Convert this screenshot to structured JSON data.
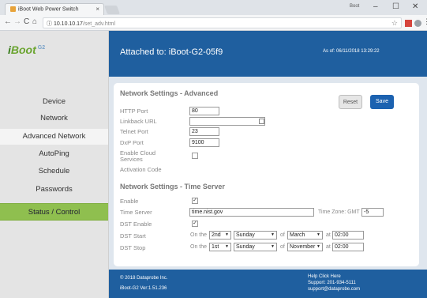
{
  "browser": {
    "tab_title": "iBoot Web Power Switch",
    "tab_close": "×",
    "user": "Boot",
    "minimize": "–",
    "maximize": "☐",
    "close": "✕",
    "back": "←",
    "forward": "→",
    "reload": "C",
    "home": "⌂",
    "info": "ⓘ",
    "url_host": "10.10.10.17",
    "url_path": "/set_adv.html",
    "bookmark": "☆",
    "menu": "⋮",
    "colors": {
      "ext1": "#d6453d",
      "ext2": "#9aa0a6"
    }
  },
  "sidebar": {
    "logo_brand": "Boot",
    "logo_i": "i",
    "logo_suffix": "G2",
    "items": [
      {
        "label": "Device"
      },
      {
        "label": "Network"
      },
      {
        "label": "Advanced Network"
      },
      {
        "label": "AutoPing"
      },
      {
        "label": "Schedule"
      },
      {
        "label": "Passwords"
      },
      {
        "label": "Status / Control"
      }
    ]
  },
  "header": {
    "attached": "Attached to: iBoot-G2-05f9",
    "as_of": "As of: 06/11/2018 13:29:22"
  },
  "advanced": {
    "title": "Network Settings - Advanced",
    "reset_label": "Reset",
    "save_label": "Save",
    "http_port_label": "HTTP Port",
    "http_port_value": "80",
    "linkback_label": "Linkback URL",
    "linkback_value": "",
    "telnet_label": "Telnet Port",
    "telnet_value": "23",
    "dxp_label": "DxP Port",
    "dxp_value": "9100",
    "cloud_label_1": "Enable Cloud",
    "cloud_label_2": "Services",
    "cloud_checked": "",
    "activation_label": "Activation Code"
  },
  "timeserver": {
    "title": "Network Settings - Time Server",
    "enable_label": "Enable",
    "enable_checked": "✓",
    "server_label": "Time Server",
    "server_value": "time.nist.gov",
    "tz_label": "Time Zone: GMT",
    "tz_value": "-5",
    "dst_enable_label": "DST Enable",
    "dst_enable_checked": "✓",
    "dst_start_label": "DST Start",
    "dst_stop_label": "DST Stop",
    "on_the": "On the",
    "of": "of",
    "at": "at",
    "start": {
      "week": "2nd",
      "day": "Sunday",
      "month": "March",
      "time": "02:00"
    },
    "stop": {
      "week": "1st",
      "day": "Sunday",
      "month": "November",
      "time": "02:00"
    },
    "dropdown_arrow": "▼"
  },
  "footer": {
    "copyright": "© 2018 Dataprobe Inc.",
    "version": "iBoot-G2 Ver:1.51.236",
    "help": "Help Click Here",
    "support_phone": "Support: 201-934-5111",
    "support_email": "support@dataprobe.com"
  }
}
